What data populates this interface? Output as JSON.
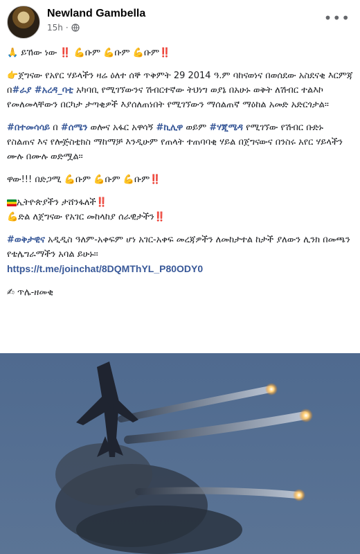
{
  "post": {
    "author": "Newland Gambella",
    "time": "15h",
    "dot": "·",
    "more_label": "•••"
  },
  "text": {
    "line1": {
      "pray": "🙏",
      "word1": "ይኸው ነው",
      "excl": "‼️",
      "muscle": "💪",
      "rep": "ቡም"
    },
    "para2": {
      "point": "👉",
      "part1": "ጀግናው የአየር ሃይላችን ዛሬ ዕለተ ሰኞ ጥቅምት 29 2014 ዓ.ም ባከናወነና በወሰደው አስደናቂ እርምጃ በ",
      "tag1": "#ራያ",
      "sp1": " ",
      "tag2": "#አረዳ_ባቲ",
      "part2": " አካባቢ የሚገኘውንና ሽብርተኛው ትህነግ ወያኔ በአሁኑ ወቅት ለሽብር ተልእኮ የመለመላቸውን በርካታ ታጣቂዎች እያሰለጠነበት የሚገኘውን ማሰልጠኛ ማዕከል አመድ አድርጎታል።"
    },
    "para3": {
      "tag1": "#በተመሳሳይ",
      "t1": " በ ",
      "tag2": "#ሰሜን",
      "t2": " ወሎና አፋር አዋሳኝ ",
      "tag3": "#ኪሊዋ",
      "t3": " ወይም ",
      "tag4": "#ሃጂሜዳ",
      "t4": " የሚገኘው የሽብር ቡድኑ የስልጠና እና የሎጅስቲክስ ማከማቻ እንዲሁም የጠላት ተጠባባቂ ሃይል በጀግናውና በንስሩ አየር ሃይላችን ሙሉ በሙሉ ወድሟል።"
    },
    "para4": {
      "word": "ዋው!!! በድጋሚ"
    },
    "para5": {
      "line1": "ኢትዮጵያችን ታሸንፋለች",
      "line2": "ድል ለጀግናው የአገር መከላከያ ሰራዊታችን"
    },
    "para6": {
      "tag": "#ወቅታዊና",
      "text": " አዲዲስ ዓለም-አቀፍም ሆነ አገር-አቀፍ መረጃዎችን ለመከታተል ከታች ያለውን ሊንክ በመጫን የቴሌግራማችን አባል ይሁኑ።",
      "link": "https://t.me/joinchat/8DQMThYL_P80ODY0"
    },
    "sign": {
      "emoji": "✍",
      "name": "ጥሌ-ዘመቂ"
    }
  },
  "colors": {
    "link": "#385898",
    "exclamation": "#d0161e",
    "muscle": "#e4a42a"
  },
  "photo": {
    "subject": "fighter jet releasing flares"
  }
}
